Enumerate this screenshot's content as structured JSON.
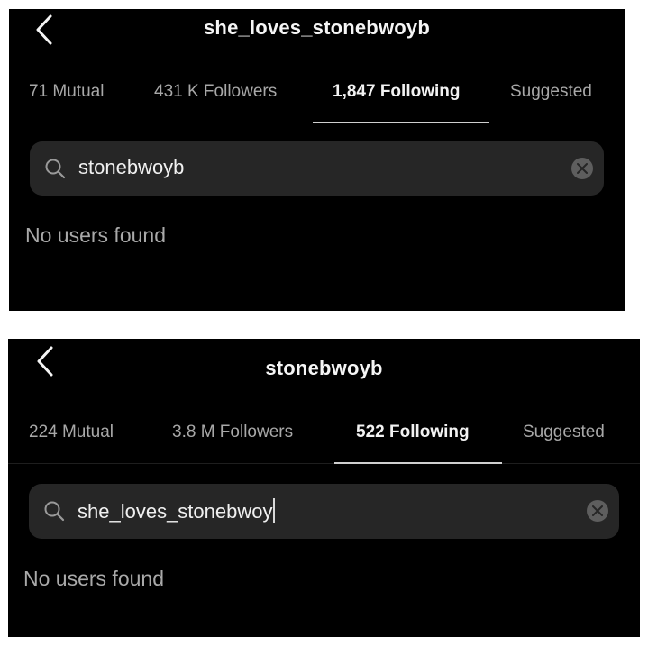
{
  "panels": [
    {
      "title": "she_loves_stonebwoyb",
      "tabs": [
        {
          "label": "71 Mutual",
          "active": false
        },
        {
          "label": "431 K Followers",
          "active": false
        },
        {
          "label": "1,847 Following",
          "active": true
        },
        {
          "label": "Suggested",
          "active": false
        }
      ],
      "search": {
        "value": "stonebwoyb",
        "icon": "search-icon",
        "clear_icon": "clear-icon"
      },
      "empty_message": "No users found"
    },
    {
      "title": "stonebwoyb",
      "tabs": [
        {
          "label": "224 Mutual",
          "active": false
        },
        {
          "label": "3.8 M Followers",
          "active": false
        },
        {
          "label": "522 Following",
          "active": true
        },
        {
          "label": "Suggested",
          "active": false
        }
      ],
      "search": {
        "value": "she_loves_stonebwoy",
        "icon": "search-icon",
        "clear_icon": "clear-icon",
        "cursor_visible": true
      },
      "empty_message": "No users found"
    }
  ],
  "icons": {
    "back": "chevron-left-icon",
    "search": "search-icon",
    "clear": "clear-icon"
  },
  "colors": {
    "background": "#000000",
    "search_field": "#262626",
    "active_text": "#f2f2f2",
    "inactive_text": "#a8a8a8",
    "clear_button": "#5e5e5e"
  }
}
